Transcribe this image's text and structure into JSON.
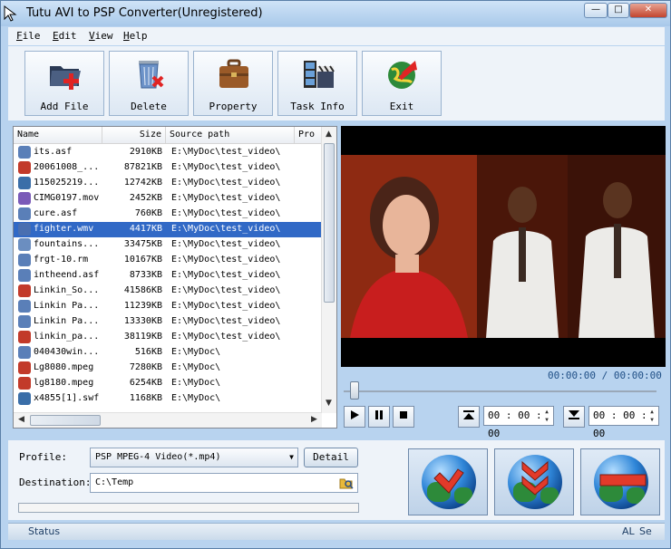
{
  "window": {
    "title": "Tutu AVI to PSP Converter(Unregistered)"
  },
  "menu": [
    "File",
    "Edit",
    "View",
    "Help"
  ],
  "toolbar": {
    "add_file": "Add File",
    "delete": "Delete",
    "property": "Property",
    "task_info": "Task Info",
    "exit": "Exit"
  },
  "table": {
    "headers": {
      "name": "Name",
      "size": "Size",
      "path": "Source path",
      "progress": "Pro"
    },
    "rows": [
      {
        "name": "its.asf",
        "size": "2910KB",
        "path": "E:\\MyDoc\\test_video\\",
        "icon": "asf-file-icon",
        "color": "#5a7fb8"
      },
      {
        "name": "20061008_...",
        "size": "87821KB",
        "path": "E:\\MyDoc\\test_video\\",
        "icon": "realmedia-file-icon",
        "color": "#c23a2a"
      },
      {
        "name": "115025219...",
        "size": "12742KB",
        "path": "E:\\MyDoc\\test_video\\",
        "icon": "quicktime-file-icon",
        "color": "#3a6ea8"
      },
      {
        "name": "CIMG0197.mov",
        "size": "2452KB",
        "path": "E:\\MyDoc\\test_video\\",
        "icon": "mov-file-icon",
        "color": "#7a5ab8"
      },
      {
        "name": "cure.asf",
        "size": "760KB",
        "path": "E:\\MyDoc\\test_video\\",
        "icon": "asf-file-icon",
        "color": "#5a7fb8"
      },
      {
        "name": "fighter.wmv",
        "size": "4417KB",
        "path": "E:\\MyDoc\\test_video\\",
        "icon": "wmv-file-icon",
        "color": "#4a6fb0",
        "selected": true
      },
      {
        "name": "fountains...",
        "size": "33475KB",
        "path": "E:\\MyDoc\\test_video\\",
        "icon": "mpeg-file-icon",
        "color": "#6b8ec0"
      },
      {
        "name": "frgt-10.rm",
        "size": "10167KB",
        "path": "E:\\MyDoc\\test_video\\",
        "icon": "rm-file-icon",
        "color": "#5a7fb8"
      },
      {
        "name": "intheend.asf",
        "size": "8733KB",
        "path": "E:\\MyDoc\\test_video\\",
        "icon": "asf-file-icon",
        "color": "#5a7fb8"
      },
      {
        "name": "Linkin_So...",
        "size": "41586KB",
        "path": "E:\\MyDoc\\test_video\\",
        "icon": "realmedia-file-icon",
        "color": "#c23a2a"
      },
      {
        "name": "Linkin Pa...",
        "size": "11239KB",
        "path": "E:\\MyDoc\\test_video\\",
        "icon": "asf-file-icon",
        "color": "#5a7fb8"
      },
      {
        "name": "Linkin Pa...",
        "size": "13330KB",
        "path": "E:\\MyDoc\\test_video\\",
        "icon": "asf-file-icon",
        "color": "#5a7fb8"
      },
      {
        "name": "linkin_pa...",
        "size": "38119KB",
        "path": "E:\\MyDoc\\test_video\\",
        "icon": "realmedia-file-icon",
        "color": "#c23a2a"
      },
      {
        "name": "040430win...",
        "size": "516KB",
        "path": "E:\\MyDoc\\",
        "icon": "asf-file-icon",
        "color": "#5a7fb8"
      },
      {
        "name": "Lg8080.mpeg",
        "size": "7280KB",
        "path": "E:\\MyDoc\\",
        "icon": "mpeg-file-icon",
        "color": "#c23a2a"
      },
      {
        "name": "lg8180.mpeg",
        "size": "6254KB",
        "path": "E:\\MyDoc\\",
        "icon": "mpeg-file-icon",
        "color": "#c23a2a"
      },
      {
        "name": "x4855[1].swf",
        "size": "1168KB",
        "path": "E:\\MyDoc\\",
        "icon": "quicktime-file-icon",
        "color": "#3a6ea8"
      }
    ]
  },
  "player": {
    "time_display": "00:00:00 / 00:00:00",
    "start_time": "00 : 00 : 00",
    "end_time": "00 : 00 : 00"
  },
  "bottom": {
    "profile_label": "Profile:",
    "profile_value": "PSP MPEG-4 Video(*.mp4)",
    "detail_label": "Detail",
    "destination_label": "Destination:",
    "destination_value": "C:\\Temp"
  },
  "status": {
    "text": "Status",
    "right1": "AL",
    "right2": "Se"
  }
}
